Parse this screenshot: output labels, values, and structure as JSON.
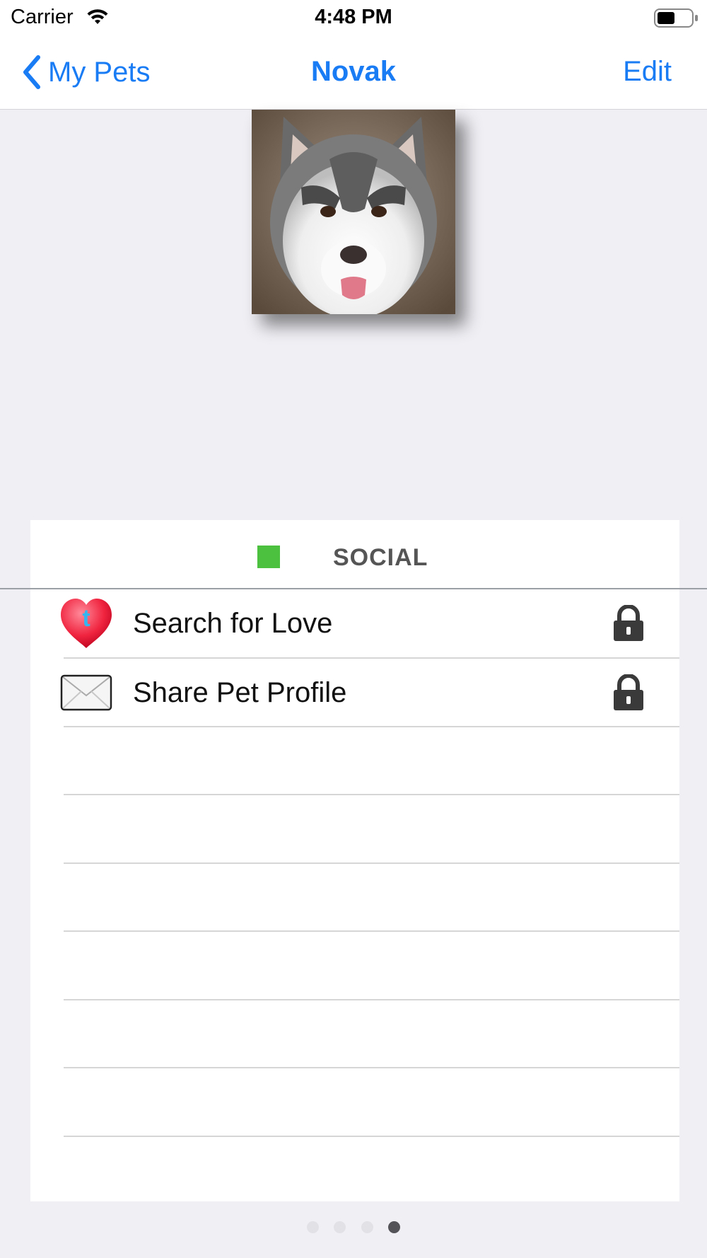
{
  "status_bar": {
    "carrier": "Carrier",
    "time": "4:48 PM"
  },
  "nav": {
    "back_label": "My Pets",
    "title": "Novak",
    "edit_label": "Edit"
  },
  "colors": {
    "accent": "#1a7cf5",
    "section_marker": "#4cc140",
    "background": "#efeff4"
  },
  "pet_photo": {
    "subject": "husky dog"
  },
  "section": {
    "title": "SOCIAL",
    "items": [
      {
        "label": "Search for Love",
        "icon": "twitter-heart-icon",
        "locked": true
      },
      {
        "label": "Share Pet Profile",
        "icon": "envelope-icon",
        "locked": true
      }
    ]
  },
  "pager": {
    "page_count": 4,
    "current_page": 4
  }
}
